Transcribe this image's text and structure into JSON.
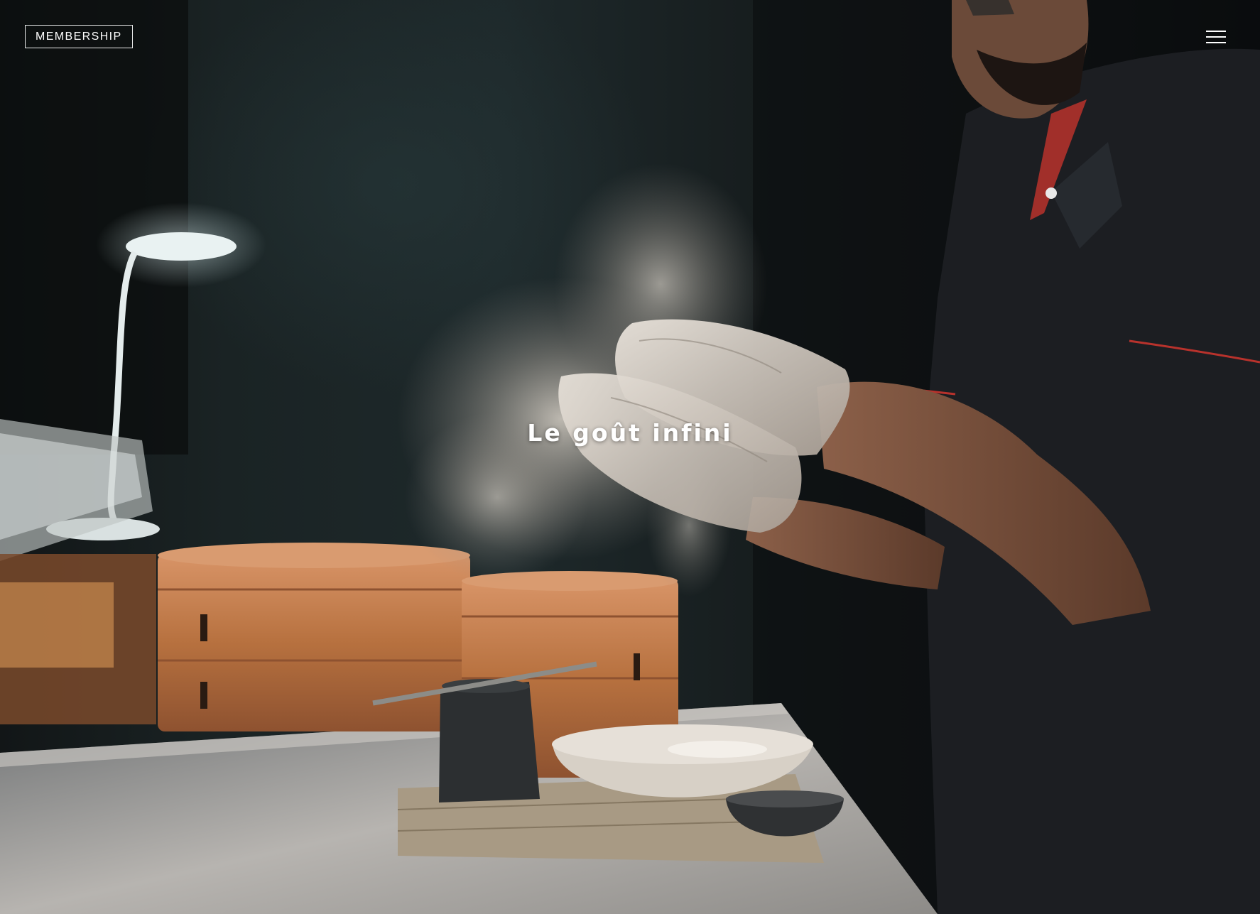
{
  "header": {
    "membership_label": "MEMBERSHIP",
    "menu_icon": "hamburger-menu-icon"
  },
  "hero": {
    "tagline": "Le goût infini",
    "image_subject": "chef-clapping-flour-over-bamboo-steamers"
  },
  "colors": {
    "text": "#ffffff",
    "background_dark": "#0f1212",
    "bamboo": "#c07a4c",
    "apron": "#1c1e22",
    "piping_red": "#b8322c"
  }
}
